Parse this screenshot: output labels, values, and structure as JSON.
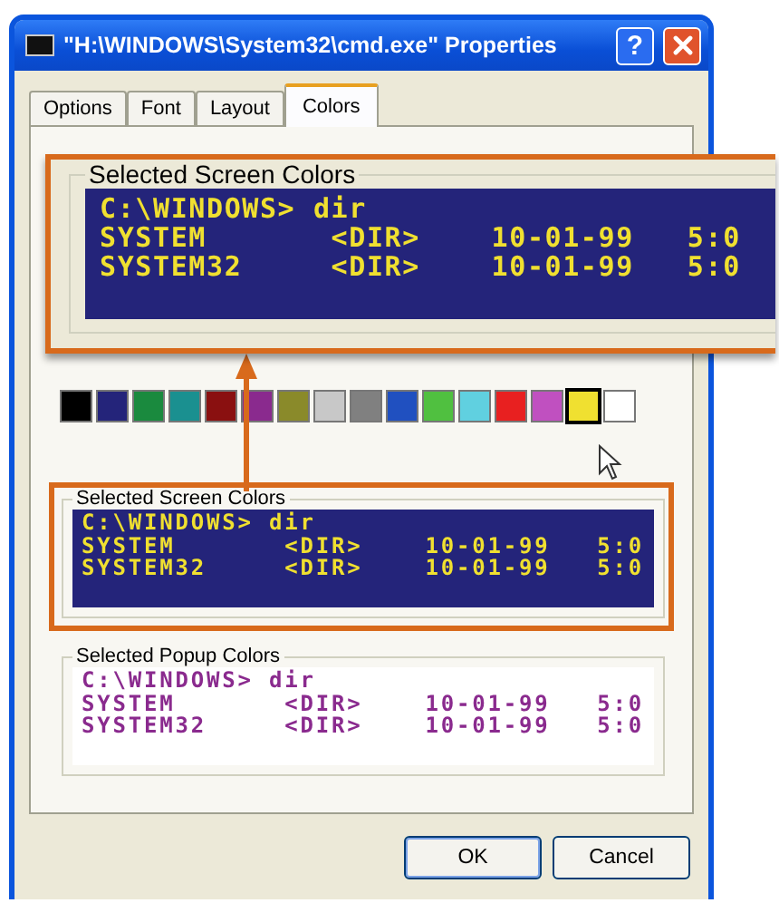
{
  "window": {
    "title": "\"H:\\WINDOWS\\System32\\cmd.exe\" Properties",
    "help_button": "?"
  },
  "tabs": [
    {
      "label": "Options",
      "selected": false
    },
    {
      "label": "Font",
      "selected": false
    },
    {
      "label": "Layout",
      "selected": false
    },
    {
      "label": "Colors",
      "selected": true
    }
  ],
  "magnified_callout": {
    "label": "Selected Screen Colors",
    "lines": [
      "C:\\WINDOWS> dir",
      "SYSTEM       <DIR>    10-01-99   5:0",
      "SYSTEM32     <DIR>    10-01-99   5:0"
    ]
  },
  "swatches": [
    {
      "color": "#000000",
      "selected": false
    },
    {
      "color": "#24247a",
      "selected": false
    },
    {
      "color": "#1a8a3e",
      "selected": false
    },
    {
      "color": "#1a9090",
      "selected": false
    },
    {
      "color": "#8a1010",
      "selected": false
    },
    {
      "color": "#8a2a8e",
      "selected": false
    },
    {
      "color": "#8a8a2a",
      "selected": false
    },
    {
      "color": "#c8c8c8",
      "selected": false
    },
    {
      "color": "#808080",
      "selected": false
    },
    {
      "color": "#2050c0",
      "selected": false
    },
    {
      "color": "#50c040",
      "selected": false
    },
    {
      "color": "#60d0e0",
      "selected": false
    },
    {
      "color": "#e82020",
      "selected": false
    },
    {
      "color": "#c050c0",
      "selected": false
    },
    {
      "color": "#f0e030",
      "selected": true
    },
    {
      "color": "#ffffff",
      "selected": false
    }
  ],
  "screen_colors": {
    "label": "Selected Screen Colors",
    "highlighted": true,
    "lines": [
      "C:\\WINDOWS> dir",
      "SYSTEM       <DIR>    10-01-99   5:0",
      "SYSTEM32     <DIR>    10-01-99   5:0"
    ]
  },
  "popup_colors": {
    "label": "Selected Popup Colors",
    "highlighted": false,
    "lines": [
      "C:\\WINDOWS> dir",
      "SYSTEM       <DIR>    10-01-99   5:0",
      "SYSTEM32     <DIR>    10-01-99   5:0"
    ]
  },
  "buttons": [
    {
      "label": "OK",
      "default": true
    },
    {
      "label": "Cancel",
      "default": false
    }
  ]
}
